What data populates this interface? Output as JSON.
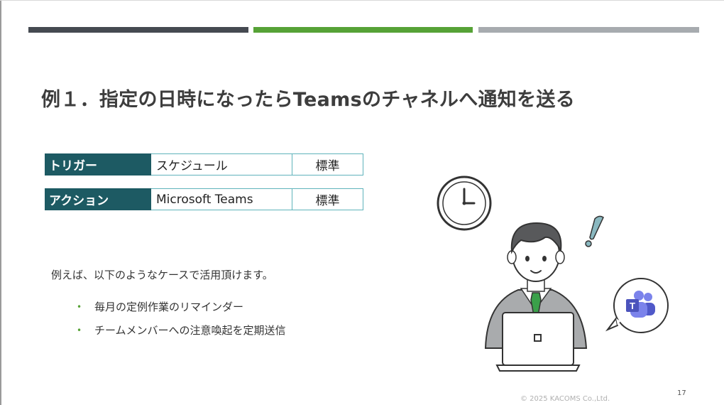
{
  "slide": {
    "title": "例１．指定の日時になったらTeamsのチャネルへ通知を送る",
    "table": [
      {
        "head": "トリガー",
        "name": "スケジュール",
        "tier": "標準"
      },
      {
        "head": "アクション",
        "name": "Microsoft Teams",
        "tier": "標準"
      }
    ],
    "intro": "例えば、以下のようなケースで活用頂けます。",
    "bullet_glyph": "•",
    "bullets": [
      "毎月の定例作業のリマインダー",
      "チームメンバーへの注意喚起を定期送信"
    ],
    "footer": {
      "copyright": "© 2025 KACOMS Co.,Ltd.",
      "page_number": "17"
    }
  },
  "illustration": {
    "clock_icon": "wall-clock",
    "person": "businessman-at-laptop",
    "exclamation_icon": "exclamation",
    "speech_bubble_icon": "microsoft-teams-logo",
    "teams_logo_letter": "T"
  },
  "colors": {
    "bar_dark": "#454a51",
    "bar_green": "#56a236",
    "bar_gray": "#a7abaf",
    "table_head": "#1d5a63",
    "table_border": "#5fb3bb",
    "teams_purple": "#5b5fc7",
    "tie_green": "#3aa04a"
  }
}
